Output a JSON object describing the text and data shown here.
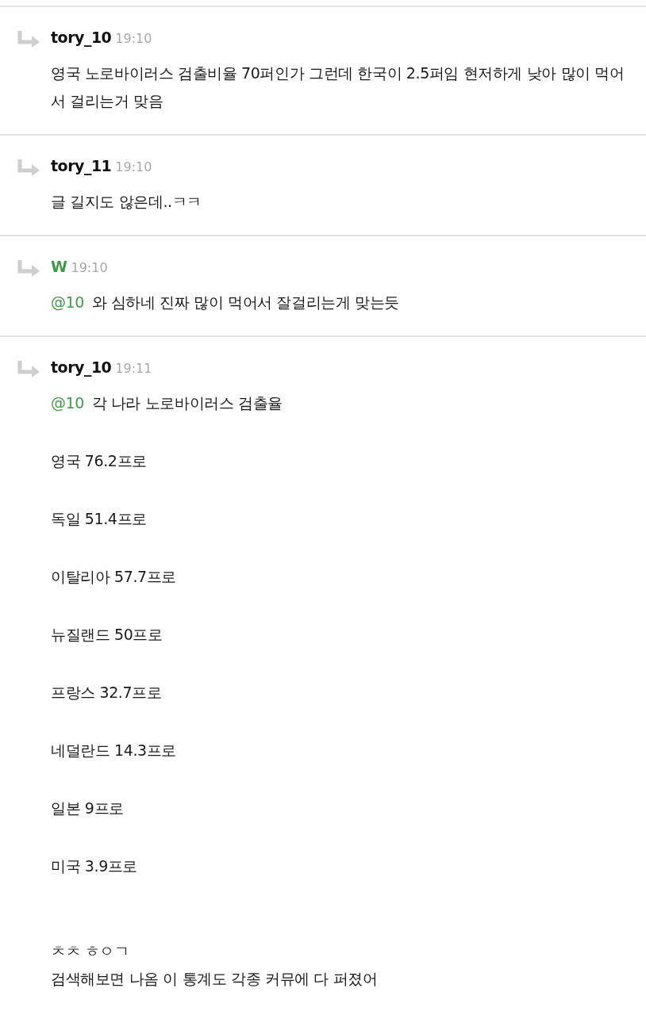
{
  "replies": [
    {
      "author": "tory_10",
      "color": "#111111",
      "time": "19:10",
      "paragraphs": [
        {
          "lines": [
            "영국 노로바이러스 검출비율 70퍼인가 그런데 한국이 2.5퍼임 현저하게 낮아 많이 먹어서 걸리는거 맞음"
          ]
        }
      ]
    },
    {
      "author": "tory_11",
      "color": "#111111",
      "time": "19:10",
      "paragraphs": [
        {
          "lines": [
            "글 길지도 않은데..ㅋㅋ"
          ]
        }
      ]
    },
    {
      "author": "W",
      "color": "#3f9a4b",
      "time": "19:10",
      "paragraphs": [
        {
          "mention": "@10",
          "lines": [
            "와 심하네 진짜 많이 먹어서 잘걸리는게 맞는듯"
          ]
        }
      ]
    },
    {
      "author": "tory_10",
      "color": "#111111",
      "time": "19:11",
      "paragraphs": [
        {
          "mention": "@10",
          "lines": [
            "각 나라 노로바이러스 검출율"
          ]
        },
        {
          "lines": [
            "영국 76.2프로"
          ]
        },
        {
          "lines": [
            "독일 51.4프로"
          ]
        },
        {
          "lines": [
            "이탈리아 57.7프로"
          ]
        },
        {
          "lines": [
            "뉴질랜드 50프로"
          ]
        },
        {
          "lines": [
            "프랑스 32.7프로"
          ]
        },
        {
          "lines": [
            "네덜란드 14.3프로"
          ]
        },
        {
          "lines": [
            "일본 9프로"
          ]
        },
        {
          "lines": [
            "미국 3.9프로"
          ]
        },
        {
          "lines": [
            "ㅊㅊ ㅎㅇㄱ",
            "검색해보면 나옴 이 통계도 각종 커뮤에 다 퍼졌어"
          ]
        }
      ]
    }
  ]
}
